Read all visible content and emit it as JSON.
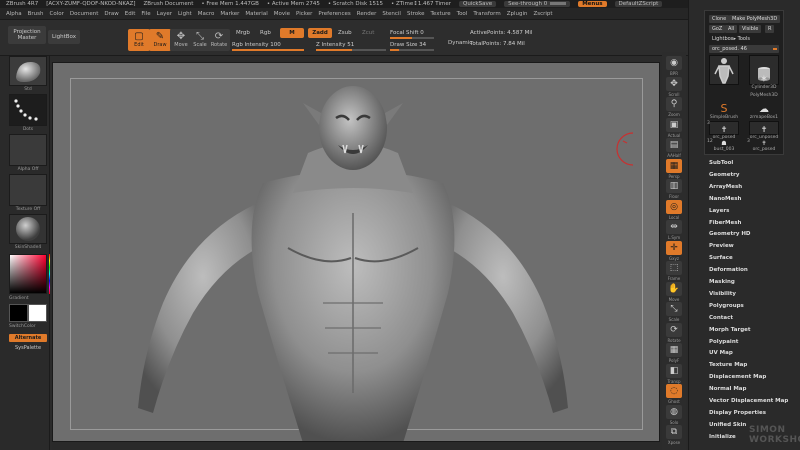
{
  "titlebar": {
    "app": "ZBrush 4R7",
    "doc_id": "[ACXY-ZUMF-QDOF-NKOD-NKAZ]",
    "document": "ZBrush Document",
    "free_mem": "• Free Mem 1.447GB",
    "active_mem": "• Active Mem 2745",
    "scratch_disk": "• Scratch Disk 1515",
    "ztime": "• ZTime↕1.467 Timer",
    "quicksave": "QuickSave",
    "see_through": "See-through 0",
    "menus": "Menus",
    "default_script": "DefaultZScript"
  },
  "menubar": {
    "items": [
      "Alpha",
      "Brush",
      "Color",
      "Document",
      "Draw",
      "Edit",
      "File",
      "Layer",
      "Light",
      "Macro",
      "Marker",
      "Material",
      "Movie",
      "Picker",
      "Preferences",
      "Render",
      "Stencil",
      "Stroke",
      "Texture",
      "Tool",
      "Transform",
      "Zplugin",
      "Zscript"
    ]
  },
  "shelf": {
    "projection_master": "Projection Master",
    "lightbox": "LightBox",
    "edit": "Edit",
    "draw": "Draw",
    "move": "Move",
    "scale": "Scale",
    "rotate": "Rotate",
    "mrgb": "Mrgb",
    "rgb": "Rgb",
    "m": "M",
    "zadd": "Zadd",
    "zsub": "Zsub",
    "zcut": "Zcut",
    "rgb_intensity": {
      "label": "Rgb Intensity 100",
      "value": 100
    },
    "z_intensity": {
      "label": "Z Intensity 51",
      "value": 51
    },
    "focal_shift": {
      "label": "Focal Shift 0",
      "value": 0
    },
    "draw_size": {
      "label": "Draw Size 34",
      "value": 34
    },
    "dynamic": "Dynamic",
    "active_points": "ActivePoints: 4.587 Mil",
    "total_points": "TotalPoints: 7.84 Mil"
  },
  "lefttray": {
    "brush_label": "Std",
    "stroke_label": "Dots",
    "alpha_label": "Alpha Off",
    "texture_label": "Texture Off",
    "material_label": "SkinShade4",
    "gradient": "Gradient",
    "switch_color": "SwitchColor",
    "alternate": "Alternate",
    "syspalette": "SysPalette"
  },
  "righttools": [
    {
      "label": "BPR",
      "icon": "render-icon",
      "glyph": "◉",
      "orange": false
    },
    {
      "label": "Scroll",
      "icon": "scroll-icon",
      "glyph": "✥",
      "orange": false
    },
    {
      "label": "Zoom",
      "icon": "zoom-icon",
      "glyph": "⚲",
      "orange": false
    },
    {
      "label": "Actual",
      "icon": "actual-icon",
      "glyph": "▣",
      "orange": false
    },
    {
      "label": "AAHalf",
      "icon": "aahalf-icon",
      "glyph": "▤",
      "orange": false
    },
    {
      "label": "Persp",
      "icon": "persp-icon",
      "glyph": "▦",
      "orange": true
    },
    {
      "label": "Floor",
      "icon": "floor-icon",
      "glyph": "▥",
      "orange": false
    },
    {
      "label": "Local",
      "icon": "local-icon",
      "glyph": "◎",
      "orange": true
    },
    {
      "label": "L.Sym",
      "icon": "lsym-icon",
      "glyph": "⇹",
      "orange": false
    },
    {
      "label": "Gxyz",
      "icon": "xyz-icon",
      "glyph": "✛",
      "orange": true
    },
    {
      "label": "Frame",
      "icon": "frame-icon",
      "glyph": "⬚",
      "orange": false
    },
    {
      "label": "Move",
      "icon": "move-icon",
      "glyph": "✋",
      "orange": false
    },
    {
      "label": "Scale",
      "icon": "scale-icon",
      "glyph": "⤡",
      "orange": false
    },
    {
      "label": "Rotate",
      "icon": "rotate-icon",
      "glyph": "⟳",
      "orange": false
    },
    {
      "label": "PolyF",
      "icon": "polyf-icon",
      "glyph": "▦",
      "orange": false
    },
    {
      "label": "Transp",
      "icon": "transp-icon",
      "glyph": "◧",
      "orange": false
    },
    {
      "label": "Ghost",
      "icon": "ghost-icon",
      "glyph": "◌",
      "orange": true
    },
    {
      "label": "Solo",
      "icon": "solo-icon",
      "glyph": "◍",
      "orange": false
    },
    {
      "label": "Xpose",
      "icon": "xpose-icon",
      "glyph": "⧉",
      "orange": false
    }
  ],
  "toolpanel": {
    "clone": "Clone",
    "make_polymesh": "Make PolyMesh3D",
    "goz": "GoZ",
    "all": "All",
    "visible": "Visible",
    "r": "R",
    "lightbox_tools": "Lightbox▸ Tools",
    "current_tool": "orc_posed. 46",
    "thumbs": [
      {
        "label": "",
        "icon": "humanoid-icon"
      },
      {
        "label": "Cylinder3D",
        "icon": "cylinder-icon"
      },
      {
        "label": "PolyMesh3D",
        "icon": "star-icon"
      },
      {
        "label": "SimpleBrush",
        "icon": "simplebrush-icon"
      },
      {
        "label": "zrmapeBox1",
        "icon": "cloud-icon"
      },
      {
        "label": "orc_posed",
        "icon": "orc-posed-icon"
      },
      {
        "label": "orc_unposed",
        "icon": "orc-unposed-icon"
      },
      {
        "label": "bust_003",
        "icon": "bust-icon"
      },
      {
        "label": "orc_posed",
        "icon": "orc-posed2-icon"
      }
    ],
    "thumb_counts": [
      "3",
      "",
      "12",
      "3"
    ]
  },
  "submenus": [
    "SubTool",
    "Geometry",
    "ArrayMesh",
    "NanoMesh",
    "Layers",
    "FiberMesh",
    "Geometry HD",
    "Preview",
    "Surface",
    "Deformation",
    "Masking",
    "Visibility",
    "Polygroups",
    "Contact",
    "Morph Target",
    "Polypaint",
    "UV Map",
    "Texture Map",
    "Displacement Map",
    "Normal Map",
    "Vector Displacement Map",
    "Display Properties",
    "Unified Skin",
    "Initialize"
  ],
  "watermark": "SIMON WORKSHOP",
  "colors": {
    "accent": "#e07a2a",
    "panel": "#2a2a2a",
    "viewport": "#6e6e6e"
  }
}
